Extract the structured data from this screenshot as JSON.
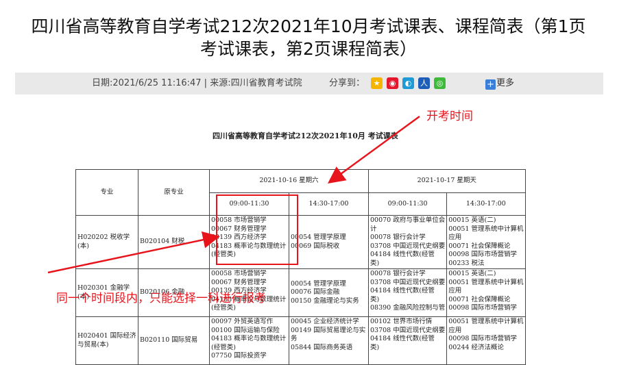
{
  "article": {
    "title_line1": "四川省高等教育自学考试212次2021年10月考试课表、课程简表（第1页",
    "title_line2": "考试课表，第2页课程简表）",
    "meta_text": "日期:2021/6/25 11:16:47 | 来源:四川省教育考试院",
    "share_label": "分享到：",
    "more_label": "更多",
    "share_icons": [
      "qzone-icon",
      "weibo-icon",
      "tencent-weibo-icon",
      "renren-icon",
      "wechat-icon"
    ]
  },
  "schedule": {
    "doc_title": "四川省高等教育自学考试212次2021年10月 考试课表",
    "head": {
      "major": "专业",
      "orig_major": "原专业",
      "day1": "2021-10-16 星期六",
      "day2": "2021-10-17 星期天",
      "am": "09:00-11:30",
      "pm": "14:30-17:00"
    },
    "rows": [
      {
        "major": "H020202 税收学(本)",
        "orig": "B020104 财税",
        "d1am": [
          "00058 市场营销学",
          "00067 财务管理学",
          "00139 西方经济学",
          "04183 概率论与数理统计",
          "(经管类)"
        ],
        "d1pm": [
          "00054 管理学原理",
          "00069 国际税收"
        ],
        "d2am": [
          "00070 政府与事业单位会",
          "计",
          "00078 银行会计学",
          "03708 中国近现代史纲要",
          "04184 线性代数(经管",
          "类)"
        ],
        "d2pm": [
          "00015 英语(二)",
          "00051 管理系统中计算机",
          "应用",
          "00071 社会保障概论",
          "00098 国际市场营销学",
          "00233 税法"
        ]
      },
      {
        "major": "H020301 金融学(本)",
        "orig": "B020106 金融",
        "d1am": [
          "00058 市场营销学",
          "00067 财务管理学",
          "00139 西方经济学",
          "04183 概率论与数理统计",
          "(经管类)"
        ],
        "d1pm": [
          "00054 管理学原理",
          "00076 国际金融",
          "00150 金融理论与实务"
        ],
        "d2am": [
          "00078 银行会计学",
          "03708 中国近现代史纲要",
          "04184 线性代数(经管",
          "类)",
          "08390 金融风险控制与管"
        ],
        "d2pm": [
          "00015 英语(二)",
          "00051 管理系统中计算机",
          "应用",
          "00071 社会保障概论",
          "00098 国际市场营销学"
        ]
      },
      {
        "major": "H020401 国际经济与贸易(本)",
        "orig": "B020110 国际贸易",
        "d1am": [
          "00097 外贸英语写作",
          "00100 国际运输与保险",
          "04183 概率论与数理统计",
          "(经管类)",
          "07750 国际投资学"
        ],
        "d1pm": [
          "00045 企业经济统计学",
          "00149 国际贸易理论与实",
          "务",
          "05844 国际商务英语"
        ],
        "d2am": [
          "00102 世界市场行情",
          "03708 中国近现代史纲要",
          "04184 线性代数(经管",
          "类)"
        ],
        "d2pm": [
          "00051 管理系统中计算机",
          "应用",
          "00098 国际市场营销学",
          "00244 经济法概论"
        ]
      }
    ]
  },
  "annotations": {
    "label_exam_time": "开考时间",
    "label_one_subject": "同一个时间段内，只能选择一科进行报考"
  },
  "colors": {
    "annotation_red": "#e8141c",
    "meta_bar": "#e9e9e9"
  }
}
